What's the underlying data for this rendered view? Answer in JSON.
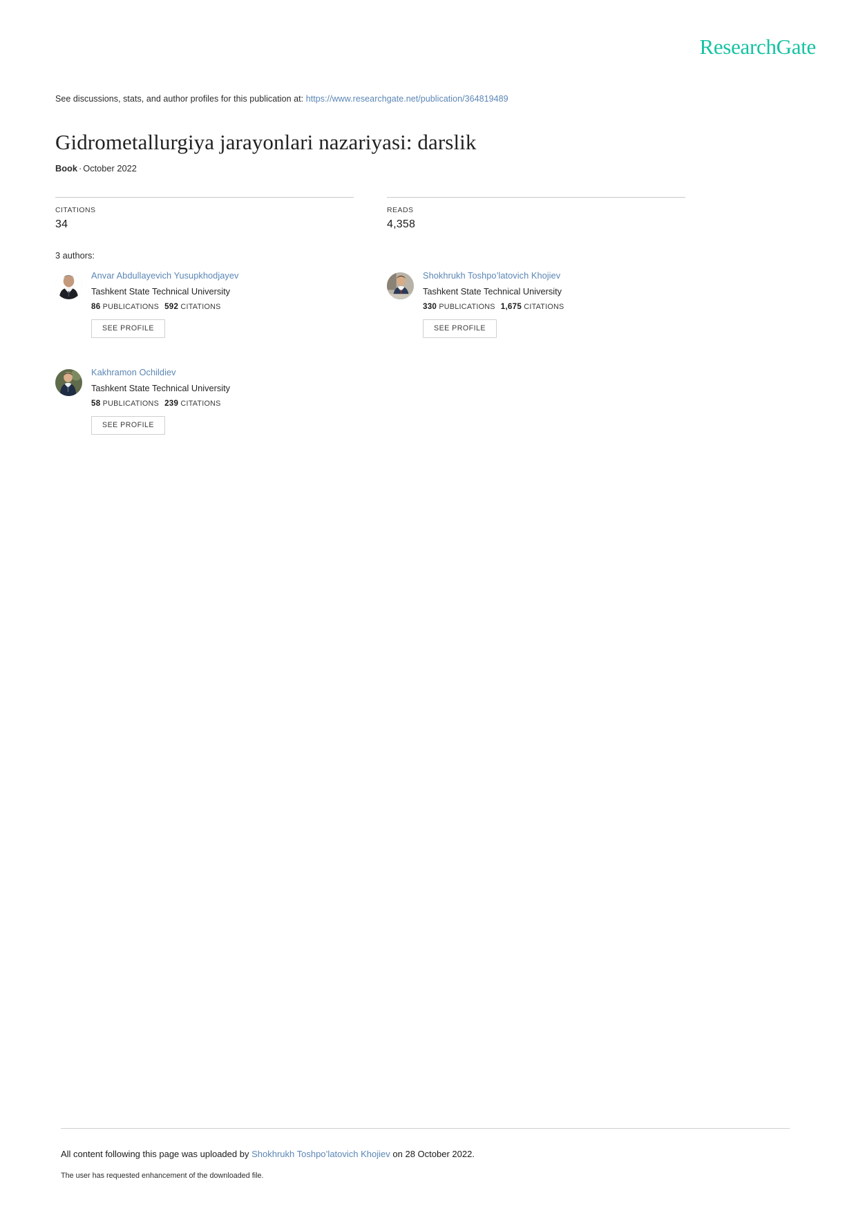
{
  "brand": {
    "logo_text": "ResearchGate",
    "accent_color": "#16c2a3",
    "link_color": "#5b86b5"
  },
  "header": {
    "discussion_prefix": "See discussions, stats, and author profiles for this publication at:",
    "publication_url": "https://www.researchgate.net/publication/364819489"
  },
  "publication": {
    "title": "Gidrometallurgiya jarayonlari nazariyasi: darslik",
    "type": "Book",
    "separator": "·",
    "date": "October 2022"
  },
  "metrics": [
    {
      "label": "CITATIONS",
      "value": "34"
    },
    {
      "label": "READS",
      "value": "4,358"
    }
  ],
  "authors_section": {
    "heading": "3 authors:",
    "see_profile_label": "SEE PROFILE",
    "publications_label": "PUBLICATIONS",
    "citations_label": "CITATIONS"
  },
  "authors": [
    {
      "name": "Anvar Abdullayevich Yusupkhodjayev",
      "affiliation": "Tashkent State Technical University",
      "publications": "86",
      "citations": "592",
      "avatar": "portrait-elder-man-suit"
    },
    {
      "name": "Shokhrukh Toshpo’latovich Khojiev",
      "affiliation": "Tashkent State Technical University",
      "publications": "330",
      "citations": "1,675",
      "avatar": "portrait-man-blue-suit-desk"
    },
    {
      "name": "Kakhramon Ochildiev",
      "affiliation": "Tashkent State Technical University",
      "publications": "58",
      "citations": "239",
      "avatar": "portrait-man-outdoors"
    }
  ],
  "footer": {
    "upload_prefix": "All content following this page was uploaded by",
    "uploader": "Shokhrukh Toshpo’latovich Khojiev",
    "upload_suffix": "on 28 October 2022.",
    "enhancement_note": "The user has requested enhancement of the downloaded file."
  }
}
